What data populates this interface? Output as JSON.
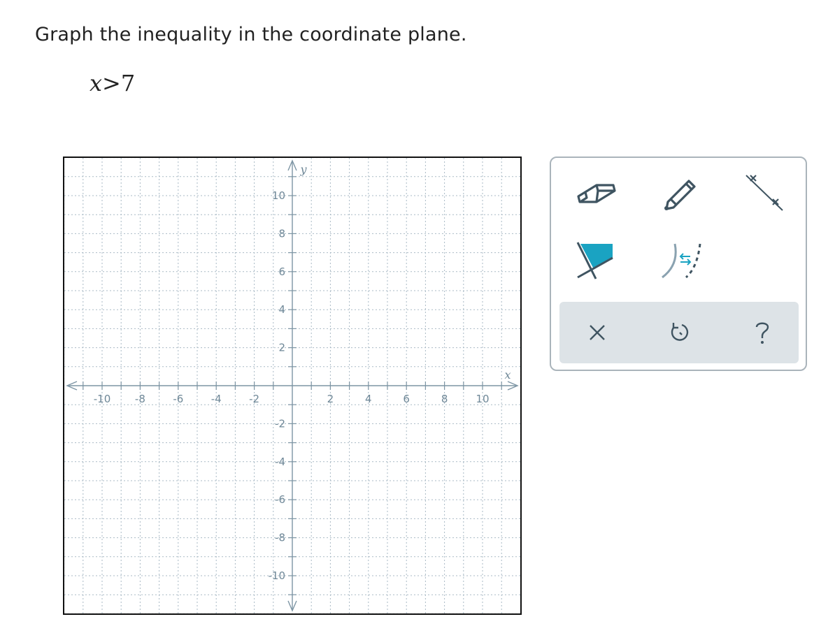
{
  "prompt": {
    "text": "Graph the inequality in the coordinate plane.",
    "inequality": {
      "variable": "x",
      "operator": ">",
      "value": "7"
    }
  },
  "graph": {
    "x_axis_label": "x",
    "y_axis_label": "y",
    "x_range": [
      -12,
      12
    ],
    "y_range": [
      -12,
      12
    ],
    "grid_step": 1,
    "x_tick_labels": [
      "-10",
      "-8",
      "-6",
      "-4",
      "-2",
      "2",
      "4",
      "6",
      "8",
      "10"
    ],
    "y_tick_labels": [
      "10",
      "8",
      "6",
      "4",
      "2",
      "-2",
      "-4",
      "-6",
      "-8",
      "-10"
    ],
    "grid_style": "dotted",
    "colors": {
      "grid": "#a9bac5",
      "axis": "#7d95a4",
      "label": "#6e8797",
      "frame": "#111111"
    }
  },
  "toolbox": {
    "tools": [
      {
        "name": "eraser-icon"
      },
      {
        "name": "pencil-icon"
      },
      {
        "name": "line-tool-icon"
      },
      {
        "name": "shade-region-icon",
        "accent": "#1aa3c2"
      },
      {
        "name": "solid-dashed-toggle-icon",
        "accent": "#1aa3c2"
      }
    ],
    "actions": [
      {
        "name": "clear-icon",
        "glyph": "×"
      },
      {
        "name": "undo-icon",
        "glyph": "↺"
      },
      {
        "name": "help-icon",
        "glyph": "?"
      }
    ],
    "colors": {
      "icon": "#3f5461",
      "border": "#aab4bb",
      "action_bg": "#dde3e7"
    }
  }
}
